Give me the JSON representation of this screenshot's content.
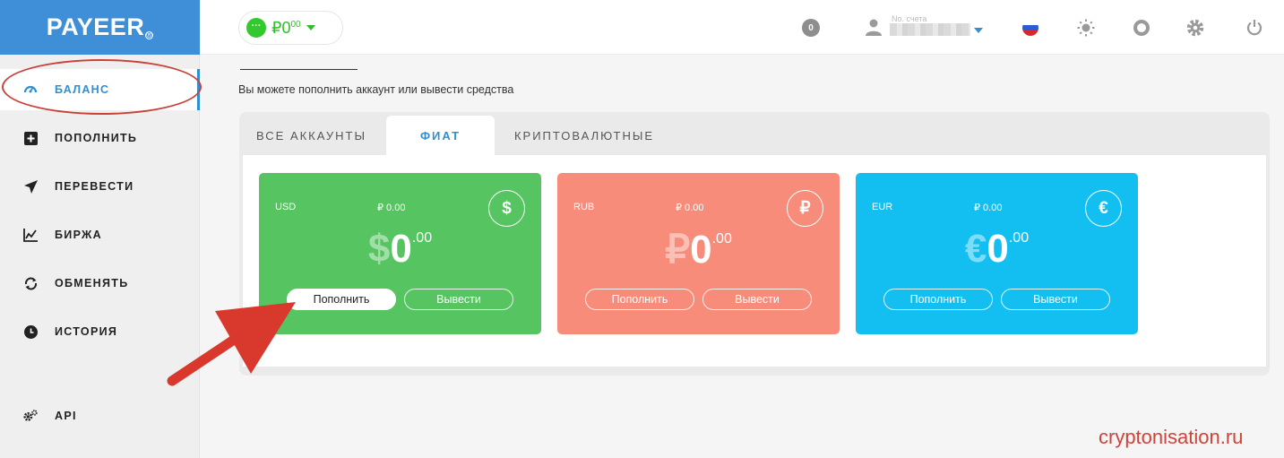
{
  "app": {
    "logo_text": "PAYEER",
    "logo_mark": "®"
  },
  "sidebar": {
    "items": [
      {
        "label": "БАЛАНС",
        "icon": "speedometer-icon",
        "active": true
      },
      {
        "label": "ПОПОЛНИТЬ",
        "icon": "plus-square-icon"
      },
      {
        "label": "ПЕРЕВЕСТИ",
        "icon": "paper-plane-icon"
      },
      {
        "label": "БИРЖА",
        "icon": "chart-line-icon"
      },
      {
        "label": "ОБМЕНЯТЬ",
        "icon": "exchange-arrows-icon"
      },
      {
        "label": "ИСТОРИЯ",
        "icon": "clock-icon"
      },
      {
        "label": "API",
        "icon": "gears-icon"
      }
    ]
  },
  "topbar": {
    "balance_dots": "···",
    "balance_symbol": "₽",
    "balance_int": "0",
    "balance_dec": "00",
    "notifications": "0",
    "account_label": "No. счета"
  },
  "main": {
    "subtitle": "Вы можете пополнить аккаунт или вывести средства",
    "tabs": [
      {
        "label": "ВСЕ АККАУНТЫ"
      },
      {
        "label": "ФИАТ",
        "active": true
      },
      {
        "label": "КРИПТОВАЛЮТНЫЕ"
      }
    ],
    "cards": [
      {
        "code": "USD",
        "rub_value": "₽ 0.00",
        "symbol": "$",
        "int": "0",
        "dec": ".00",
        "color": "#55c461",
        "deposit": "Пополнить",
        "withdraw": "Вывести"
      },
      {
        "code": "RUB",
        "rub_value": "₽ 0.00",
        "symbol": "₽",
        "int": "0",
        "dec": ".00",
        "color": "#f78c7b",
        "deposit": "Пополнить",
        "withdraw": "Вывести"
      },
      {
        "code": "EUR",
        "rub_value": "₽ 0.00",
        "symbol": "€",
        "int": "0",
        "dec": ".00",
        "color": "#13bff0",
        "deposit": "Пополнить",
        "withdraw": "Вывести"
      }
    ]
  },
  "watermark": "cryptonisation.ru",
  "colors": {
    "brand": "#3f8fd8",
    "accent": "#2f8fd4",
    "annotation": "#d9382d"
  }
}
